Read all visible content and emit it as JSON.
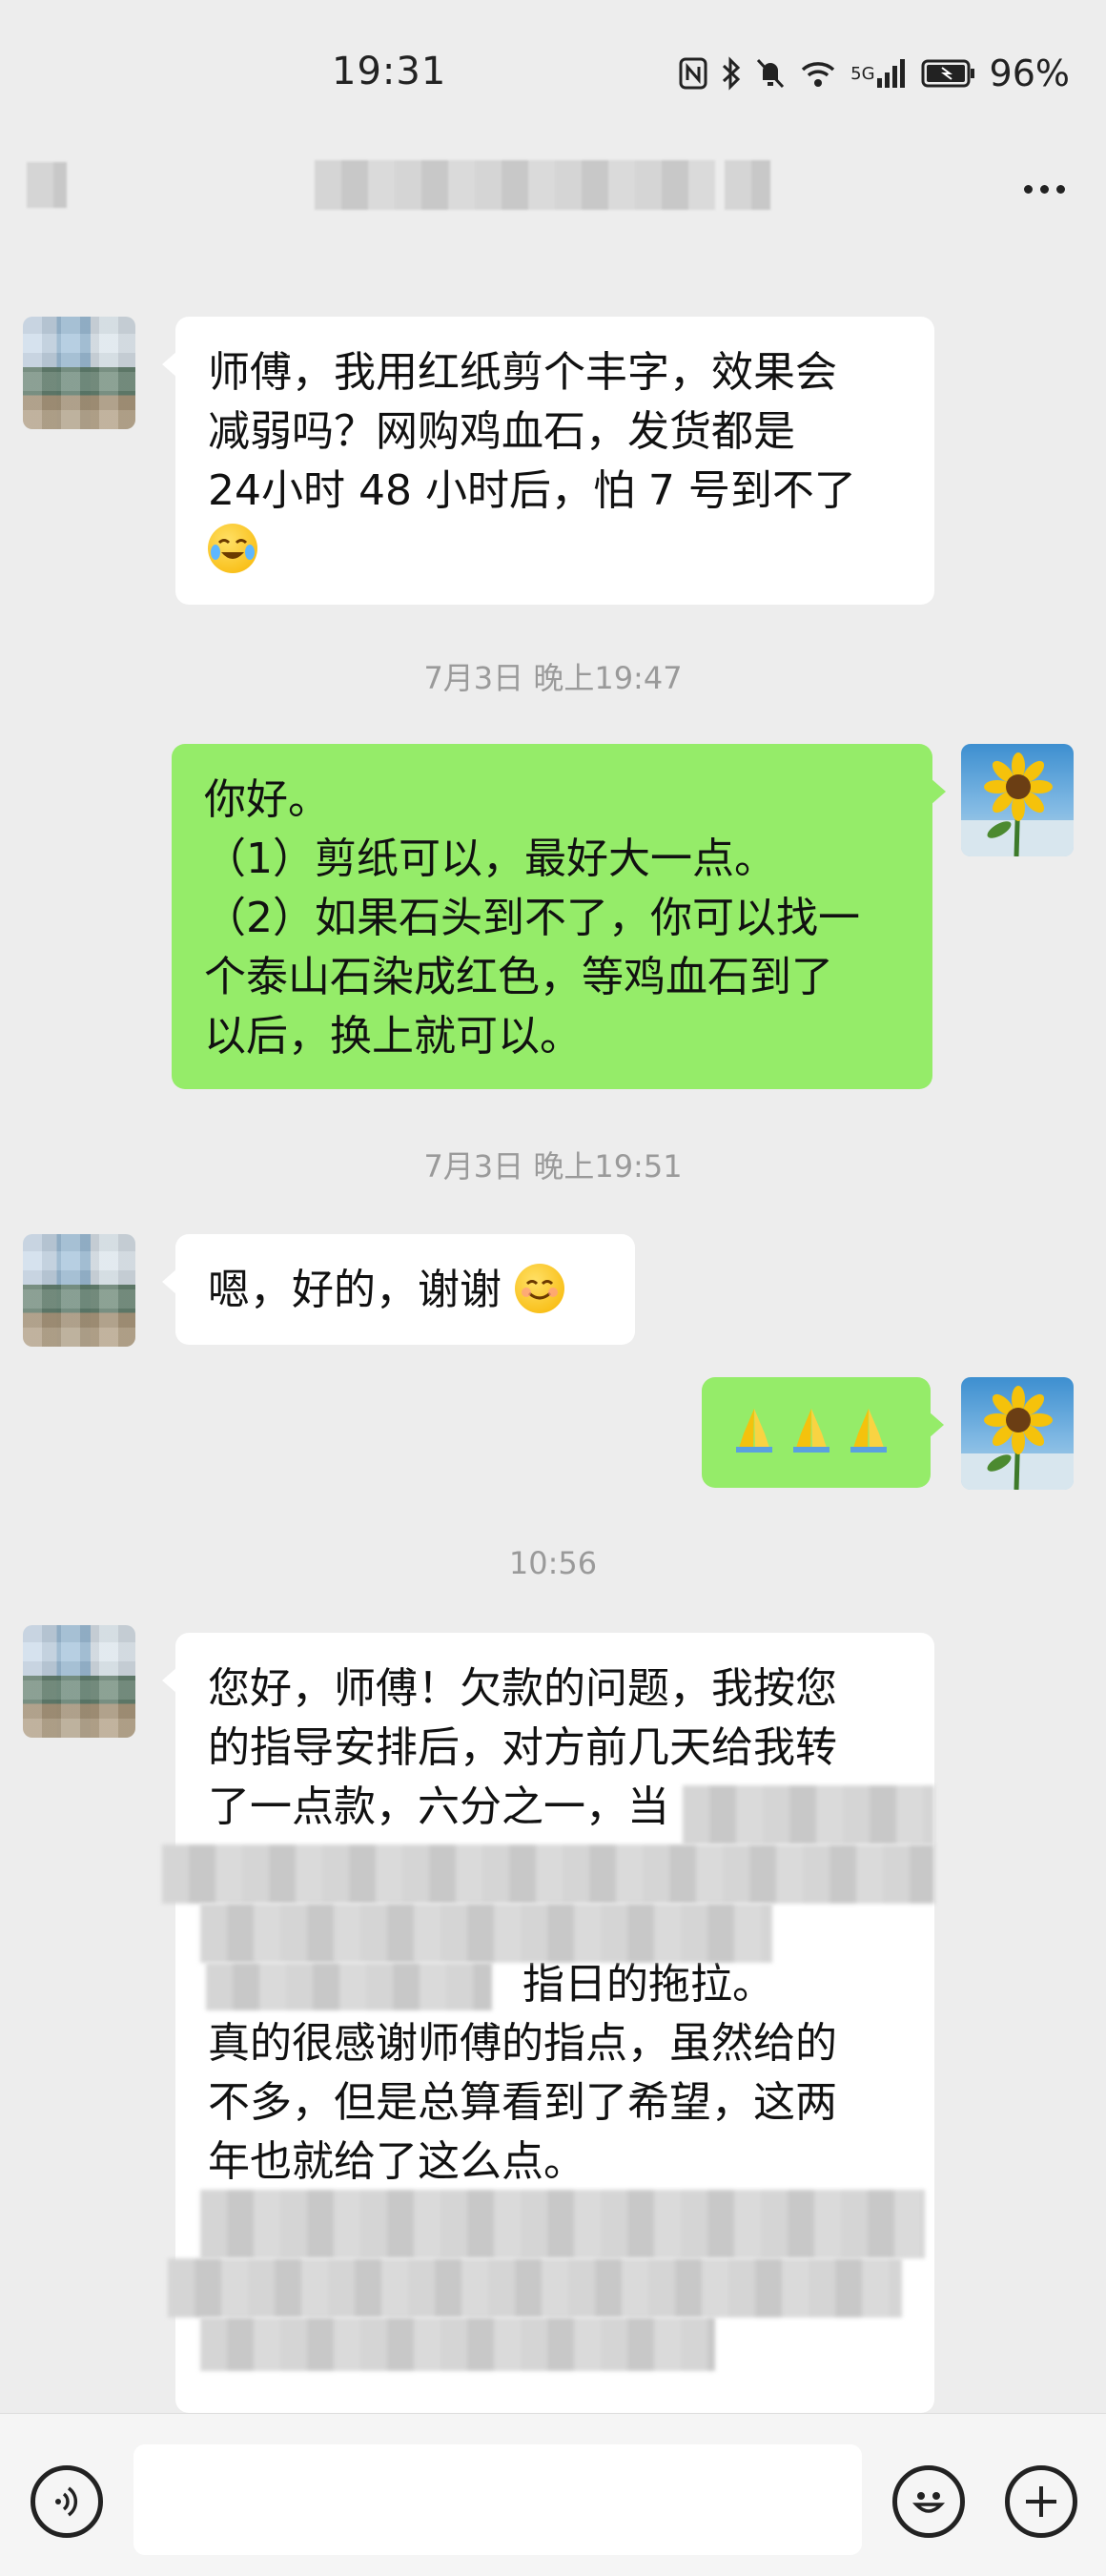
{
  "status_bar": {
    "time": "19:31",
    "network_label": "5G",
    "battery": "96%"
  },
  "nav": {
    "more_icon": "more-dots-icon"
  },
  "messages": [
    {
      "side": "left",
      "avatar": "blurred-avatar",
      "lines": [
        "师傅，我用红纸剪个丰字，效果会",
        "减弱吗？网购鸡血石，发货都是",
        "24小时 48 小时后，怕 7 号到不了"
      ],
      "trailing_emoji": "crying-laughing-emoji"
    },
    {
      "timestamp": "7月3日 晚上19:47"
    },
    {
      "side": "right",
      "avatar": "sunflower-avatar",
      "lines": [
        "你好。",
        "（1）剪纸可以，最好大一点。",
        "（2）如果石头到不了，你可以找一",
        "个泰山石染成红色，等鸡血石到了",
        "以后，换上就可以。"
      ]
    },
    {
      "timestamp": "7月3日 晚上19:51"
    },
    {
      "side": "left",
      "avatar": "blurred-avatar",
      "text": "嗯，好的，谢谢",
      "trailing_emoji": "smiling-face-emoji"
    },
    {
      "side": "right",
      "avatar": "sunflower-avatar",
      "emojis": [
        "folded-hands-emoji",
        "folded-hands-emoji",
        "folded-hands-emoji"
      ]
    },
    {
      "timestamp": "10:56"
    },
    {
      "side": "left",
      "avatar": "blurred-avatar",
      "lines_visible": [
        "您好，师傅！欠款的问题，我按您",
        "的指导安排后，对方前几天给我转",
        "了一点款，六分之一，当",
        "指日的拖拉。",
        "真的很感谢师傅的指点，虽然给的",
        "不多，但是总算看到了希望，这两",
        "年也就给了这么点。"
      ]
    }
  ],
  "input_bar": {
    "voice_icon": "voice-icon",
    "emoji_icon": "emoji-icon",
    "plus_icon": "plus-icon"
  }
}
